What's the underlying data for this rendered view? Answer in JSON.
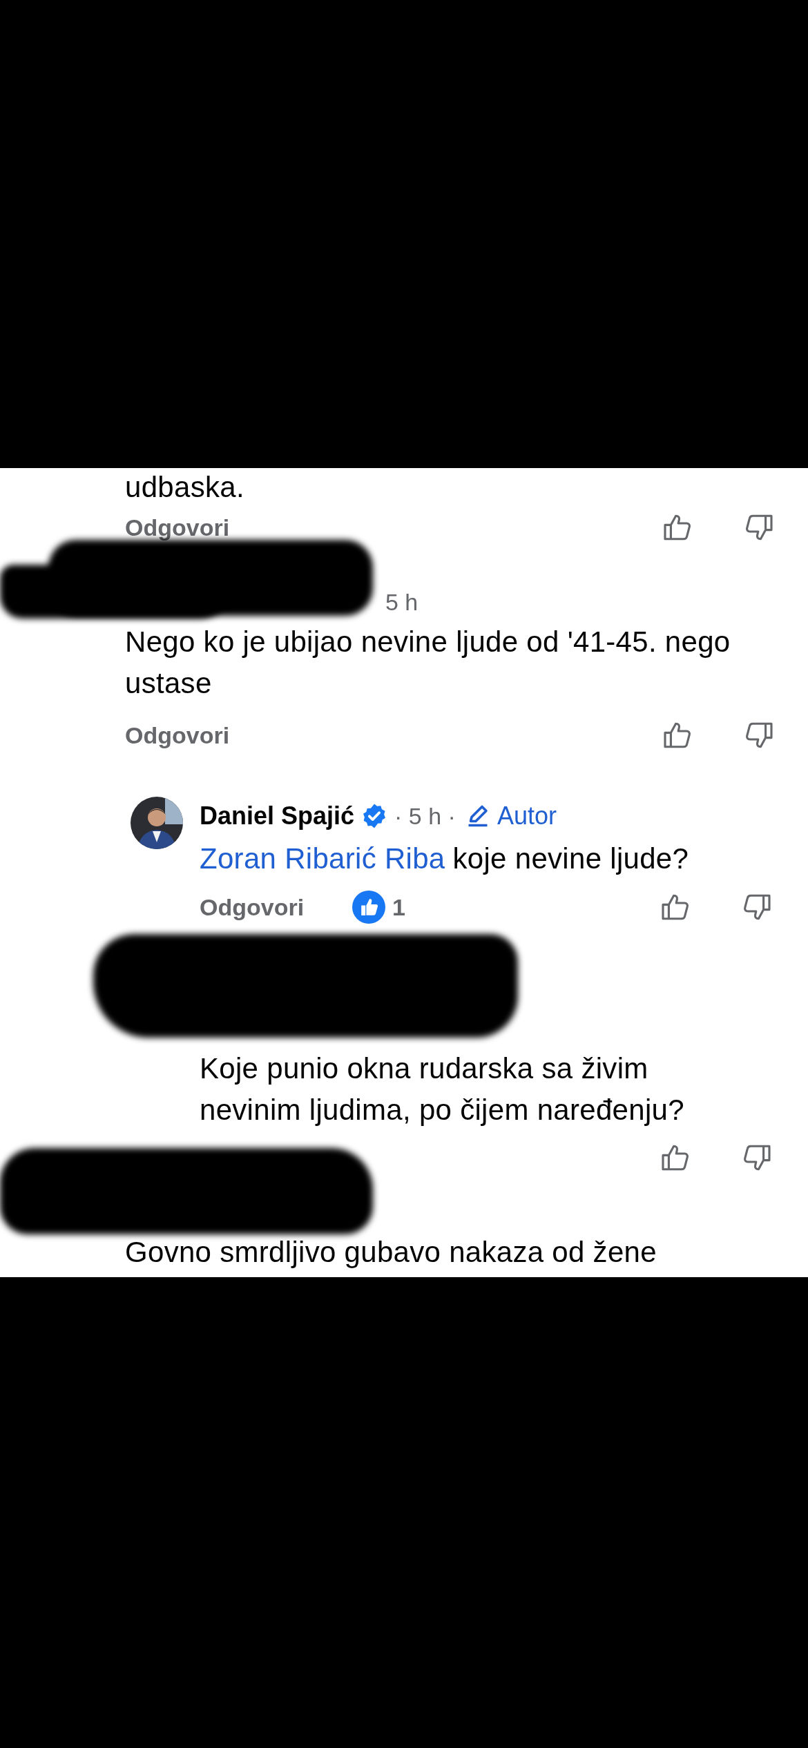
{
  "comments": [
    {
      "indented": false,
      "text": "udbaska.",
      "reply_label": "Odgovori",
      "reactions": true
    },
    {
      "indented": false,
      "time": "5 h",
      "text": "Nego ko je ubijao nevine ljude od '41-45. nego ustase",
      "reply_label": "Odgovori",
      "reactions": true
    },
    {
      "indented": true,
      "author": "Daniel Spajić",
      "verified": true,
      "time": "· 5 h ·",
      "author_badge": "Autor",
      "mention": "Zoran Ribarić Riba",
      "text": "koje nevine ljude?",
      "reply_label": "Odgovori",
      "like_count": "1",
      "reactions": true
    },
    {
      "indented": true,
      "text": "Koje punio okna rudarska sa živim nevinim ljudima, po čijem naređenju?",
      "reactions": true
    },
    {
      "indented": false,
      "text": "Govno smrdljivo gubavo nakaza od žene",
      "reactions": false
    }
  ]
}
